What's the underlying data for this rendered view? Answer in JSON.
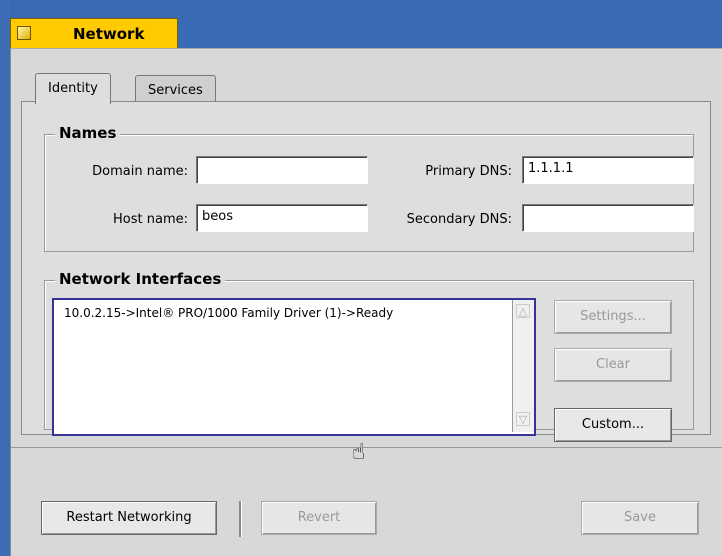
{
  "window": {
    "title": "Network"
  },
  "tabs": [
    {
      "label": "Identity"
    },
    {
      "label": "Services"
    }
  ],
  "names": {
    "group_title": "Names",
    "domain_label": "Domain name:",
    "domain_value": "",
    "host_label": "Host name:",
    "host_value": "beos",
    "primary_dns_label": "Primary DNS:",
    "primary_dns_value": "1.1.1.1",
    "secondary_dns_label": "Secondary DNS:",
    "secondary_dns_value": ""
  },
  "interfaces": {
    "group_title": "Network Interfaces",
    "items": [
      "10.0.2.15->Intel® PRO/1000 Family Driver (1)->Ready"
    ],
    "settings_label": "Settings...",
    "clear_label": "Clear",
    "custom_label": "Custom..."
  },
  "bottom": {
    "restart_label": "Restart Networking",
    "revert_label": "Revert",
    "save_label": "Save"
  },
  "icons": {
    "cursor": "hand-pointer-icon",
    "up": "scroll-up-icon",
    "down": "scroll-down-icon"
  },
  "colors": {
    "title_tab": "#ffcb00",
    "desktop": "#3b6ab4",
    "list_border": "#343494"
  }
}
